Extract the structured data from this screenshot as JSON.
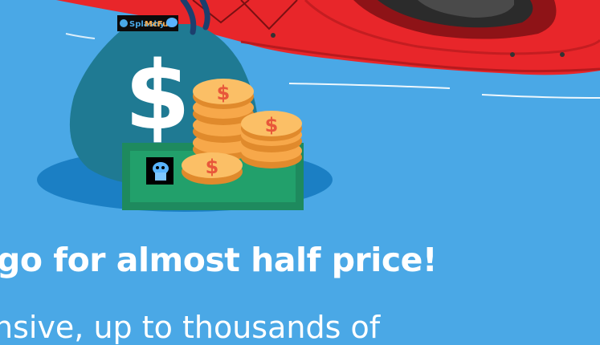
{
  "promo": {
    "headline": "go for almost half price!",
    "subtext": "nsive, up to thousands of"
  },
  "brand": {
    "name_part1": "Splashy",
    "name_part2": "McFun"
  },
  "illustration": {
    "bag_symbol": "$",
    "coin_symbol": "$",
    "icons": [
      "money-bag-icon",
      "coin-stack-icon",
      "banknote-icon",
      "kayak-image"
    ]
  },
  "colors": {
    "background": "#4aa8e6",
    "kayak": "#e8262a",
    "bag": "#1f7a93",
    "coin": "#f7a84a",
    "bill": "#1e8a5e",
    "text": "#ffffff"
  }
}
